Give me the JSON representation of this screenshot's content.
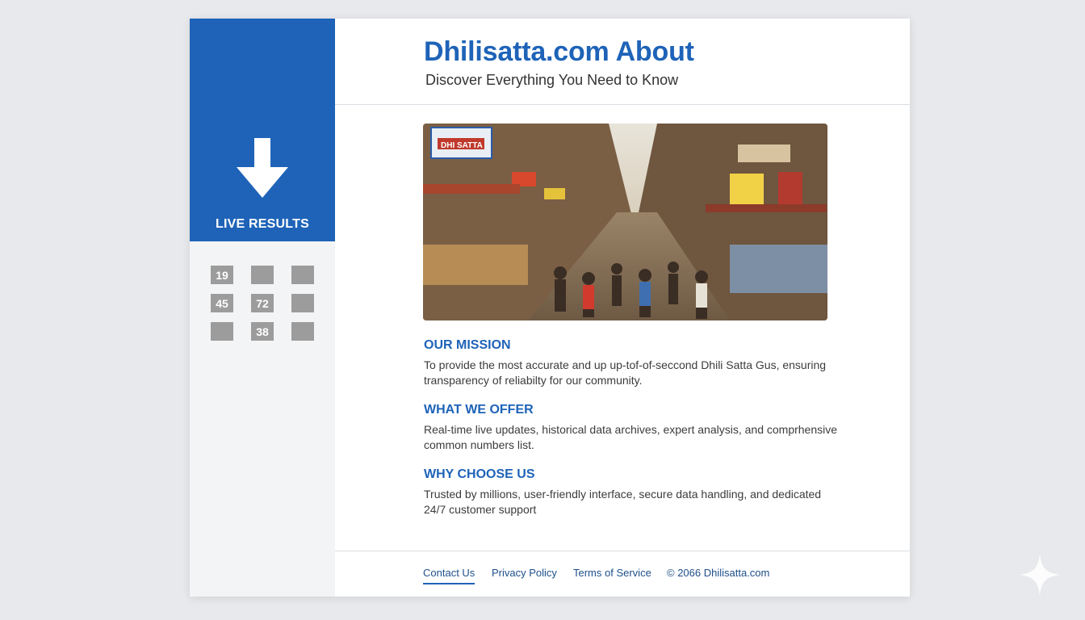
{
  "sidebar": {
    "live_label": "LIVE RESULTS",
    "numbers": [
      "19",
      "",
      "",
      "45",
      "72",
      "",
      "",
      "38",
      ""
    ]
  },
  "header": {
    "title": "Dhilisatta.com About",
    "subtitle": "Discover Everything You Need to Know"
  },
  "hero": {
    "banner_text": "DHI SATTA"
  },
  "sections": [
    {
      "heading": "OUR MISSION",
      "body": "To provide the most accurate and up up-tof-of-seccond Dhili Satta Gus, ensuring transparency of reliabilty for our community."
    },
    {
      "heading": "WHAT WE OFFER",
      "body": "Real-time live updates, historical data archives, expert analysis, and comprhensive common numbers list."
    },
    {
      "heading": "WHY CHOOSE US",
      "body": "Trusted by millions, user-friendly interface, secure data handling, and dedicated 24/7 customer support"
    }
  ],
  "footer": {
    "contact": "Contact Us",
    "privacy": "Privacy Policy",
    "terms": "Terms of Service",
    "copyright": "© 2066 Dhilisatta.com"
  },
  "colors": {
    "accent": "#1e63b8",
    "cell": "#9c9c9c",
    "background": "#e7e9ec"
  },
  "icons": {
    "download": "download-arrow-icon",
    "sparkle": "sparkle-icon"
  }
}
